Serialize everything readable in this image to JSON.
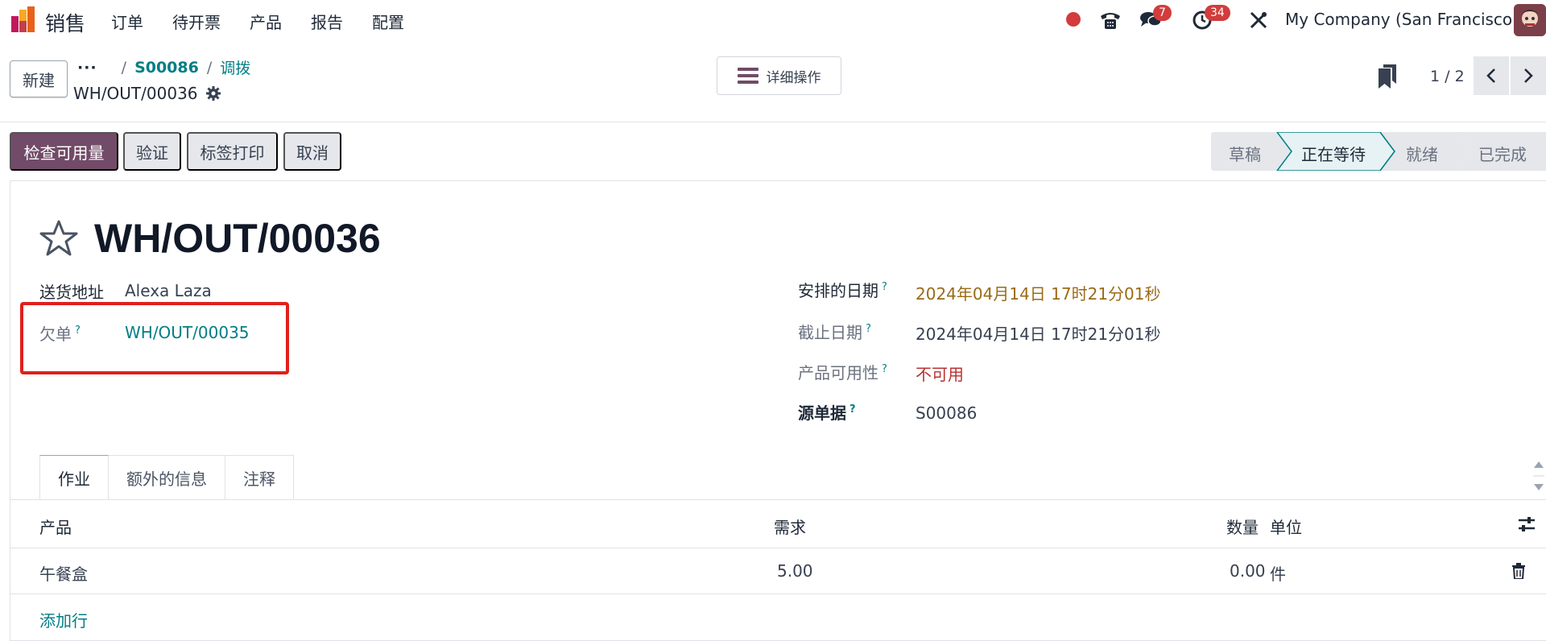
{
  "navbar": {
    "app_name": "销售",
    "menu": [
      "订单",
      "待开票",
      "产品",
      "报告",
      "配置"
    ],
    "messages_count": "7",
    "activities_count": "34",
    "company": "My Company (San Francisco)",
    "icons": [
      "recording-dot-icon",
      "phone-icon",
      "chat-icon",
      "clock-icon",
      "tools-icon"
    ]
  },
  "control_panel": {
    "new_label": "新建",
    "breadcrumb_dots": "···",
    "breadcrumb": [
      "S00086",
      "调拨"
    ],
    "record_name": "WH/OUT/00036",
    "actions_label": "详细操作",
    "pager": "1 / 2"
  },
  "statusbar": {
    "buttons": [
      "检查可用量",
      "验证",
      "标签打印",
      "取消"
    ],
    "stages": [
      "草稿",
      "正在等待",
      "就绪",
      "已完成"
    ],
    "current_stage": "正在等待"
  },
  "form": {
    "title": "WH/OUT/00036",
    "delivery_address_label": "送货地址",
    "delivery_address": "Alexa Laza",
    "backorder_label": "欠单",
    "backorder": "WH/OUT/00035",
    "scheduled_date_label": "安排的日期",
    "scheduled_date": "2024年04月14日 17时21分01秒",
    "deadline_label": "截止日期",
    "deadline": "2024年04月14日 17时21分01秒",
    "availability_label": "产品可用性",
    "availability": "不可用",
    "source_label": "源单据",
    "source": "S00086",
    "help_mark": "?"
  },
  "tabs": [
    "作业",
    "额外的信息",
    "注释"
  ],
  "table": {
    "headers": [
      "产品",
      "需求",
      "数量",
      "单位"
    ],
    "rows": [
      {
        "product": "午餐盒",
        "demand": "5.00",
        "quantity": "0.00",
        "uom": "件"
      }
    ],
    "add_line": "添加行"
  },
  "colors": {
    "primary": "#714b67",
    "link": "#017e84",
    "warning_date": "#9a6b16",
    "danger": "#b83232",
    "highlight_box": "#e0201c"
  }
}
